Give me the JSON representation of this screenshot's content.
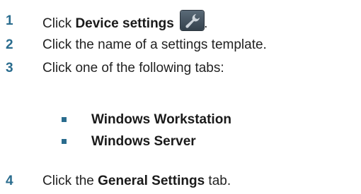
{
  "steps": [
    {
      "number": "1",
      "before": "Click ",
      "bold": "Device settings",
      "after": ".",
      "icon": "wrench-icon"
    },
    {
      "number": "2",
      "text": "Click the name of a settings template."
    },
    {
      "number": "3",
      "text": "Click one of the following tabs:"
    },
    {
      "number": "4",
      "before": "Click the ",
      "bold": "General Settings",
      "after": " tab."
    }
  ],
  "tabs": [
    "Windows Workstation",
    "Windows Server"
  ],
  "colors": {
    "accent": "#2a6c8e",
    "text": "#222222",
    "icon_bg": "#34414c"
  }
}
